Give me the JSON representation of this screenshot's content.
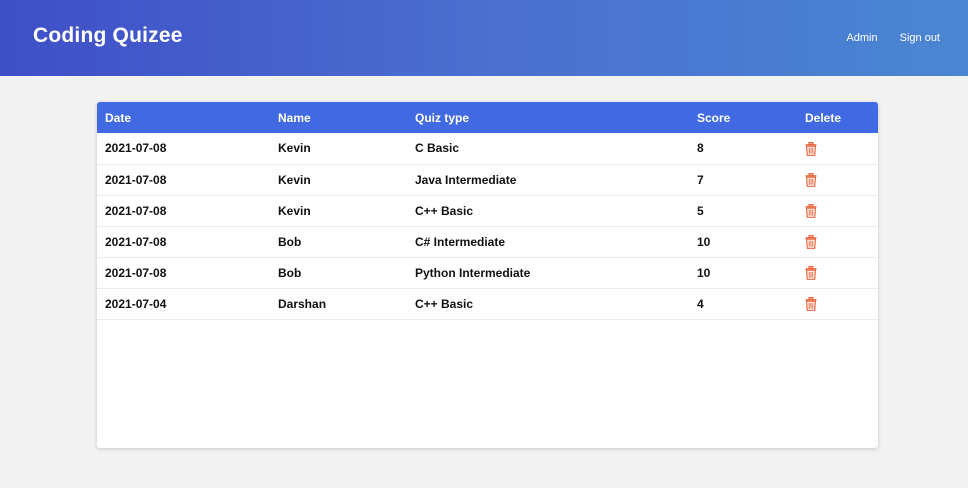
{
  "navbar": {
    "brand": "Coding Quizee",
    "links": [
      "Admin",
      "Sign out"
    ]
  },
  "table": {
    "headers": [
      "Date",
      "Name",
      "Quiz type",
      "Score",
      "Delete"
    ],
    "rows": [
      {
        "date": "2021-07-08",
        "name": "Kevin",
        "quiz": "C Basic",
        "score": "8"
      },
      {
        "date": "2021-07-08",
        "name": "Kevin",
        "quiz": "Java Intermediate",
        "score": "7"
      },
      {
        "date": "2021-07-08",
        "name": "Kevin",
        "quiz": "C++ Basic",
        "score": "5"
      },
      {
        "date": "2021-07-08",
        "name": "Bob",
        "quiz": "C# Intermediate",
        "score": "10"
      },
      {
        "date": "2021-07-08",
        "name": "Bob",
        "quiz": "Python Intermediate",
        "score": "10"
      },
      {
        "date": "2021-07-04",
        "name": "Darshan",
        "quiz": "C++ Basic",
        "score": "4"
      }
    ]
  },
  "colors": {
    "header_bg": "#4169e1",
    "navbar_start": "#3f4fc7",
    "navbar_end": "#4a86d2",
    "trash_icon": "#e8663d"
  },
  "icons": {
    "delete": "trash-icon"
  }
}
